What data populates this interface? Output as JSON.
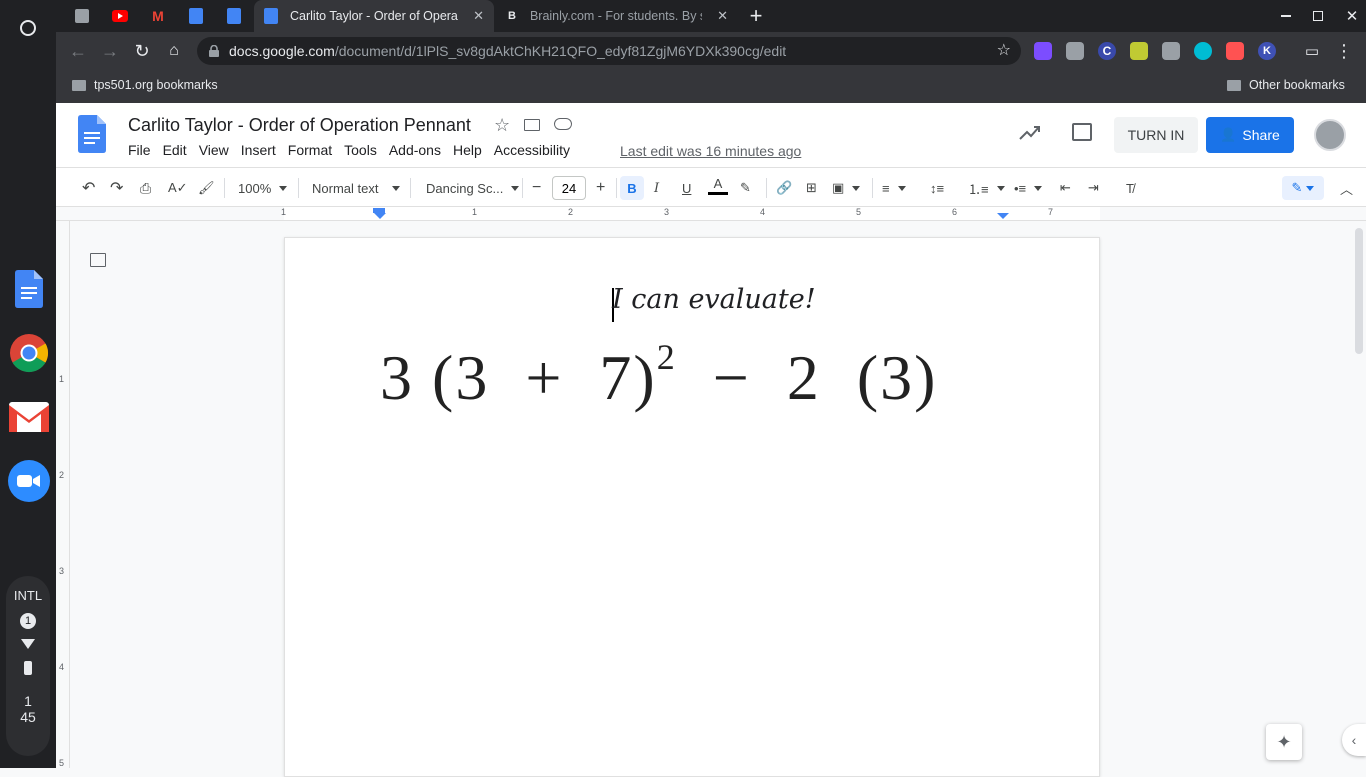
{
  "browser": {
    "tabs": [
      {
        "title": "Carlito Taylor - Order of Operation Pennant",
        "active": true
      },
      {
        "title": "Brainly.com - For students. By students",
        "active": false
      }
    ],
    "url_host": "docs.google.com",
    "url_path": "/document/d/1lPlS_sv8gdAktChKH21QFO_edyf81ZgjM6YDXk390cg/edit",
    "bookmarks": {
      "left": "tps501.org bookmarks",
      "right": "Other bookmarks"
    }
  },
  "doc": {
    "title": "Carlito Taylor - Order of Operation Pennant",
    "menus": [
      "File",
      "Edit",
      "View",
      "Insert",
      "Format",
      "Tools",
      "Add-ons",
      "Help",
      "Accessibility"
    ],
    "last_edit": "Last edit was 16 minutes ago",
    "turn_in_label": "TURN IN",
    "share_label": "Share"
  },
  "toolbar": {
    "zoom": "100%",
    "style": "Normal text",
    "font": "Dancing Sc...",
    "font_size": "24",
    "bold_active": true
  },
  "ruler": {
    "labels": [
      "1",
      "1",
      "2",
      "3",
      "4",
      "5",
      "6",
      "7"
    ]
  },
  "vruler": {
    "labels": [
      "1",
      "2",
      "3",
      "4",
      "5"
    ]
  },
  "content": {
    "heading": "I can evaluate!",
    "expression": {
      "pre": "3 (3  +  7)",
      "exponent": "2",
      "post": "  −  2  (3)"
    }
  },
  "shelf": {
    "ime": "INTL",
    "notification_count": "1",
    "time_hour": "1",
    "time_minute": "45"
  },
  "colors": {
    "accent": "#1a73e8",
    "chrome_dark": "#202124",
    "chrome_mid": "#35363a"
  }
}
